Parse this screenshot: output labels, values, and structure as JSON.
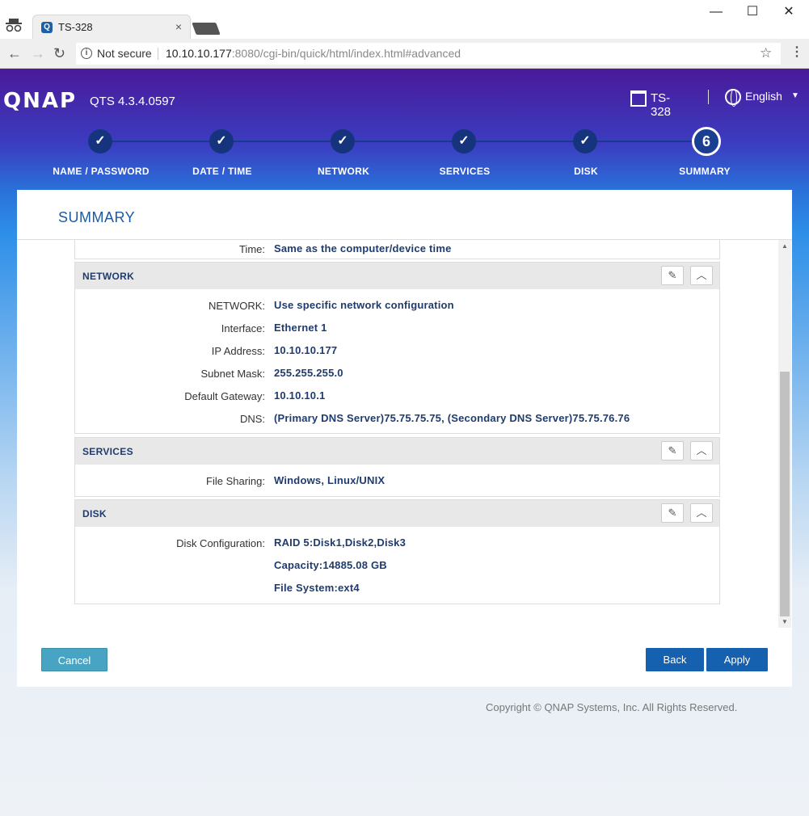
{
  "browser": {
    "tab_title": "TS-328",
    "tab_close": "×",
    "not_secure": "Not secure",
    "url_host": "10.10.10.177",
    "url_rest": ":8080/cgi-bin/quick/html/index.html#advanced",
    "minimize": "—",
    "maximize": "☐",
    "close": "✕"
  },
  "header": {
    "logo": "QNAP",
    "version": "QTS 4.3.4.0597",
    "model": "TS-328",
    "language": "English"
  },
  "steps": [
    {
      "label": "NAME / PASSWORD",
      "mark": "✓"
    },
    {
      "label": "DATE / TIME",
      "mark": "✓"
    },
    {
      "label": "NETWORK",
      "mark": "✓"
    },
    {
      "label": "SERVICES",
      "mark": "✓"
    },
    {
      "label": "DISK",
      "mark": "✓"
    },
    {
      "label": "SUMMARY",
      "mark": "6"
    }
  ],
  "card": {
    "title": "SUMMARY",
    "time_row": {
      "label": "Time:",
      "value": "Same as the computer/device time"
    },
    "network": {
      "title": "NETWORK",
      "rows": [
        {
          "label": "NETWORK:",
          "value": "Use specific network configuration"
        },
        {
          "label": "Interface:",
          "value": "Ethernet 1"
        },
        {
          "label": "IP Address:",
          "value": "10.10.10.177"
        },
        {
          "label": "Subnet Mask:",
          "value": "255.255.255.0"
        },
        {
          "label": "Default Gateway:",
          "value": "10.10.10.1"
        },
        {
          "label": "DNS:",
          "value": "(Primary DNS Server)75.75.75.75, (Secondary DNS Server)75.75.76.76"
        }
      ]
    },
    "services": {
      "title": "SERVICES",
      "rows": [
        {
          "label": "File Sharing:",
          "value": "Windows, Linux/UNIX"
        }
      ]
    },
    "disk": {
      "title": "DISK",
      "rows": [
        {
          "label": "Disk Configuration:",
          "value": "RAID 5:Disk1,Disk2,Disk3"
        },
        {
          "label": "",
          "value": "Capacity:14885.08 GB"
        },
        {
          "label": "",
          "value": "File System:ext4"
        }
      ]
    },
    "buttons": {
      "cancel": "Cancel",
      "back": "Back",
      "apply": "Apply"
    }
  },
  "footer": {
    "copyright": "Copyright © QNAP Systems, Inc. All Rights Reserved."
  }
}
